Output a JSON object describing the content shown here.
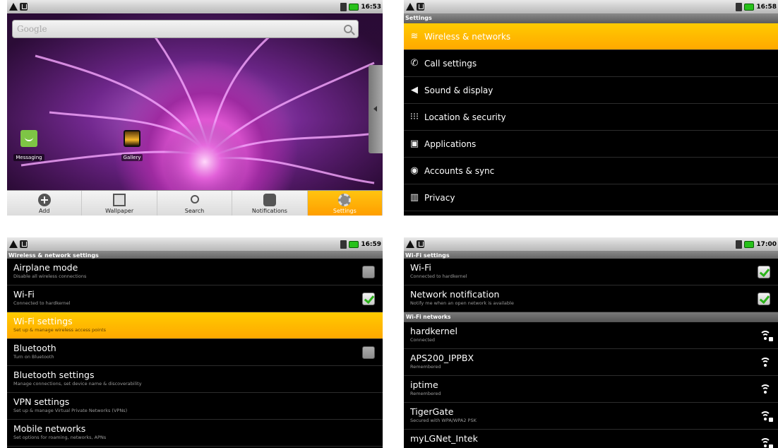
{
  "panels": {
    "home": {
      "status_time": "16:53",
      "search_placeholder": "Google",
      "shortcuts": [
        {
          "label": "Messaging"
        },
        {
          "label": "Gallery"
        }
      ],
      "dock": [
        {
          "label": "Add",
          "icon": "add-icon"
        },
        {
          "label": "Wallpaper",
          "icon": "wallpaper-icon"
        },
        {
          "label": "Search",
          "icon": "search-icon"
        },
        {
          "label": "Notifications",
          "icon": "notifications-icon"
        },
        {
          "label": "Settings",
          "icon": "settings-icon",
          "active": true
        }
      ]
    },
    "settings": {
      "status_time": "16:58",
      "title": "Settings",
      "items": [
        {
          "label": "Wireless & networks",
          "icon": "wireless-icon",
          "selected": true
        },
        {
          "label": "Call settings",
          "icon": "phone-icon"
        },
        {
          "label": "Sound & display",
          "icon": "speaker-icon"
        },
        {
          "label": "Location & security",
          "icon": "grid-icon"
        },
        {
          "label": "Applications",
          "icon": "applications-icon"
        },
        {
          "label": "Accounts & sync",
          "icon": "sync-icon"
        },
        {
          "label": "Privacy",
          "icon": "privacy-icon"
        }
      ]
    },
    "wireless": {
      "status_time": "16:59",
      "title": "Wireless & network settings",
      "items": [
        {
          "title": "Airplane mode",
          "summary": "Disable all wireless connections",
          "checkbox": "off"
        },
        {
          "title": "Wi-Fi",
          "summary": "Connected to hardkernel",
          "checkbox": "on"
        },
        {
          "title": "Wi-Fi settings",
          "summary": "Set up & manage wireless access points",
          "selected": true
        },
        {
          "title": "Bluetooth",
          "summary": "Turn on Bluetooth",
          "checkbox": "off"
        },
        {
          "title": "Bluetooth settings",
          "summary": "Manage connections, set device name & discoverability"
        },
        {
          "title": "VPN settings",
          "summary": "Set up & manage Virtual Private Networks (VPNs)"
        },
        {
          "title": "Mobile networks",
          "summary": "Set options for roaming, networks, APNs"
        }
      ]
    },
    "wifi": {
      "status_time": "17:00",
      "title": "Wi-Fi settings",
      "toggles": [
        {
          "title": "Wi-Fi",
          "summary": "Connected to hardkernel",
          "checkbox": "on"
        },
        {
          "title": "Network notification",
          "summary": "Notify me when an open network is available",
          "checkbox": "on"
        }
      ],
      "networks_header": "Wi-Fi networks",
      "networks": [
        {
          "title": "hardkernel",
          "summary": "Connected",
          "secured": true
        },
        {
          "title": "APS200_IPPBX",
          "summary": "Remembered",
          "secured": false
        },
        {
          "title": "iptime",
          "summary": "Remembered",
          "secured": false
        },
        {
          "title": "TigerGate",
          "summary": "Secured with WPA/WPA2 PSK",
          "secured": true
        },
        {
          "title": "myLGNet_Intek",
          "summary": "",
          "secured": true
        }
      ]
    }
  },
  "colors": {
    "selection": "#ffb400",
    "checkbox_check": "#2bb21a",
    "battery": "#27c11a"
  }
}
